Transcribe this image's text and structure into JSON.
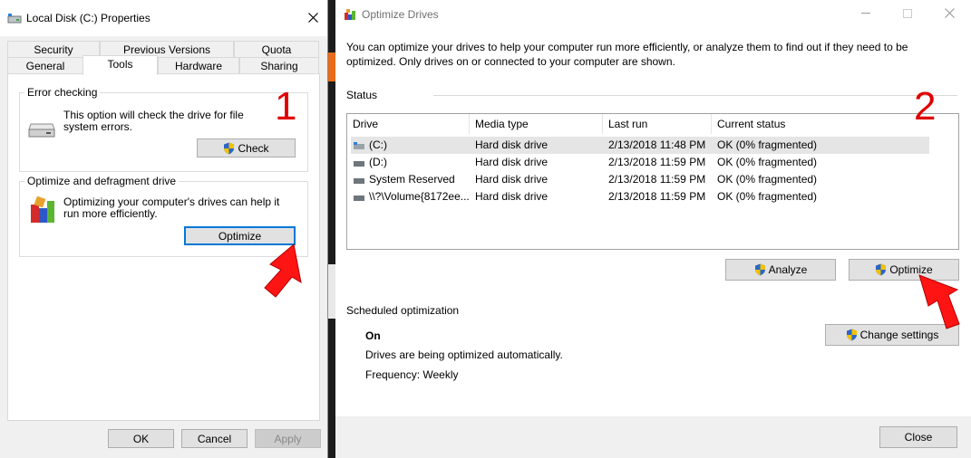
{
  "properties": {
    "title": "Local Disk (C:) Properties",
    "tabs_row1": [
      "Security",
      "Previous Versions",
      "Quota"
    ],
    "tabs_row2": [
      "General",
      "Tools",
      "Hardware",
      "Sharing"
    ],
    "active_tab": "Tools",
    "error_checking": {
      "title": "Error checking",
      "description": "This option will check the drive for file system errors.",
      "button": "Check"
    },
    "optimize": {
      "title": "Optimize and defragment drive",
      "description": "Optimizing your computer's drives can help it run more efficiently.",
      "button": "Optimize"
    },
    "buttons": {
      "ok": "OK",
      "cancel": "Cancel",
      "apply": "Apply"
    },
    "annotation": "1"
  },
  "optimize_drives": {
    "title": "Optimize Drives",
    "intro": "You can optimize your drives to help your computer run more efficiently, or analyze them to find out if they need to be optimized. Only drives on or connected to your computer are shown.",
    "status_label": "Status",
    "columns": [
      "Drive",
      "Media type",
      "Last run",
      "Current status"
    ],
    "drives": [
      {
        "drive": "(C:)",
        "media": "Hard disk drive",
        "last_run": "2/13/2018 11:48 PM",
        "status": "OK (0% fragmented)"
      },
      {
        "drive": "(D:)",
        "media": "Hard disk drive",
        "last_run": "2/13/2018 11:59 PM",
        "status": "OK (0% fragmented)"
      },
      {
        "drive": "System Reserved",
        "media": "Hard disk drive",
        "last_run": "2/13/2018 11:59 PM",
        "status": "OK (0% fragmented)"
      },
      {
        "drive": "\\\\?\\Volume{8172ee...",
        "media": "Hard disk drive",
        "last_run": "2/13/2018 11:59 PM",
        "status": "OK (0% fragmented)"
      }
    ],
    "buttons": {
      "analyze": "Analyze",
      "optimize": "Optimize",
      "change_settings": "Change settings",
      "close": "Close"
    },
    "scheduled": {
      "label": "Scheduled optimization",
      "state": "On",
      "description": "Drives are being optimized automatically.",
      "frequency": "Frequency: Weekly"
    },
    "annotation": "2"
  },
  "colors": {
    "annotation_red": "#e00000",
    "focus_blue": "#0078d7",
    "selected_row": "#e5e5e5"
  }
}
